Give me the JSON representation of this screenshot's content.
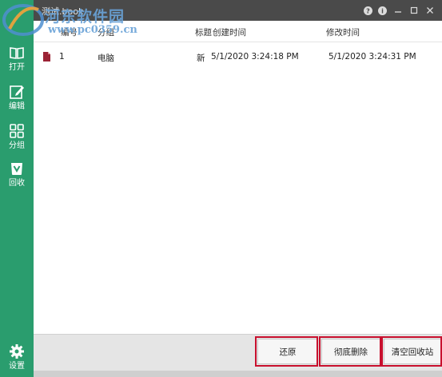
{
  "window": {
    "title": "测试.book"
  },
  "watermark": {
    "text": "河东软件园",
    "url": "www.pc0359.cn"
  },
  "sidebar": {
    "items": [
      {
        "label": "打开",
        "icon": "book-open-icon"
      },
      {
        "label": "编辑",
        "icon": "edit-icon"
      },
      {
        "label": "分组",
        "icon": "grid-icon"
      },
      {
        "label": "回收",
        "icon": "recycle-bin-icon"
      }
    ],
    "settings": {
      "label": "设置",
      "icon": "gear-icon"
    }
  },
  "table": {
    "columns": [
      "编号",
      "分组",
      "标题",
      "创建时间",
      "修改时间"
    ],
    "rows": [
      {
        "id": "1",
        "group": "电脑",
        "title": "新",
        "created": "5/1/2020 3:24:18 PM",
        "modified": "5/1/2020 3:24:31 PM"
      }
    ]
  },
  "buttons": {
    "restore": "还原",
    "delete_permanently": "彻底删除",
    "empty_bin": "清空回收站"
  },
  "colors": {
    "sidebar": "#2a9d6e",
    "titlebar": "#4a4a4a",
    "highlight": "#c8102e",
    "doc_icon": "#9b2335"
  }
}
